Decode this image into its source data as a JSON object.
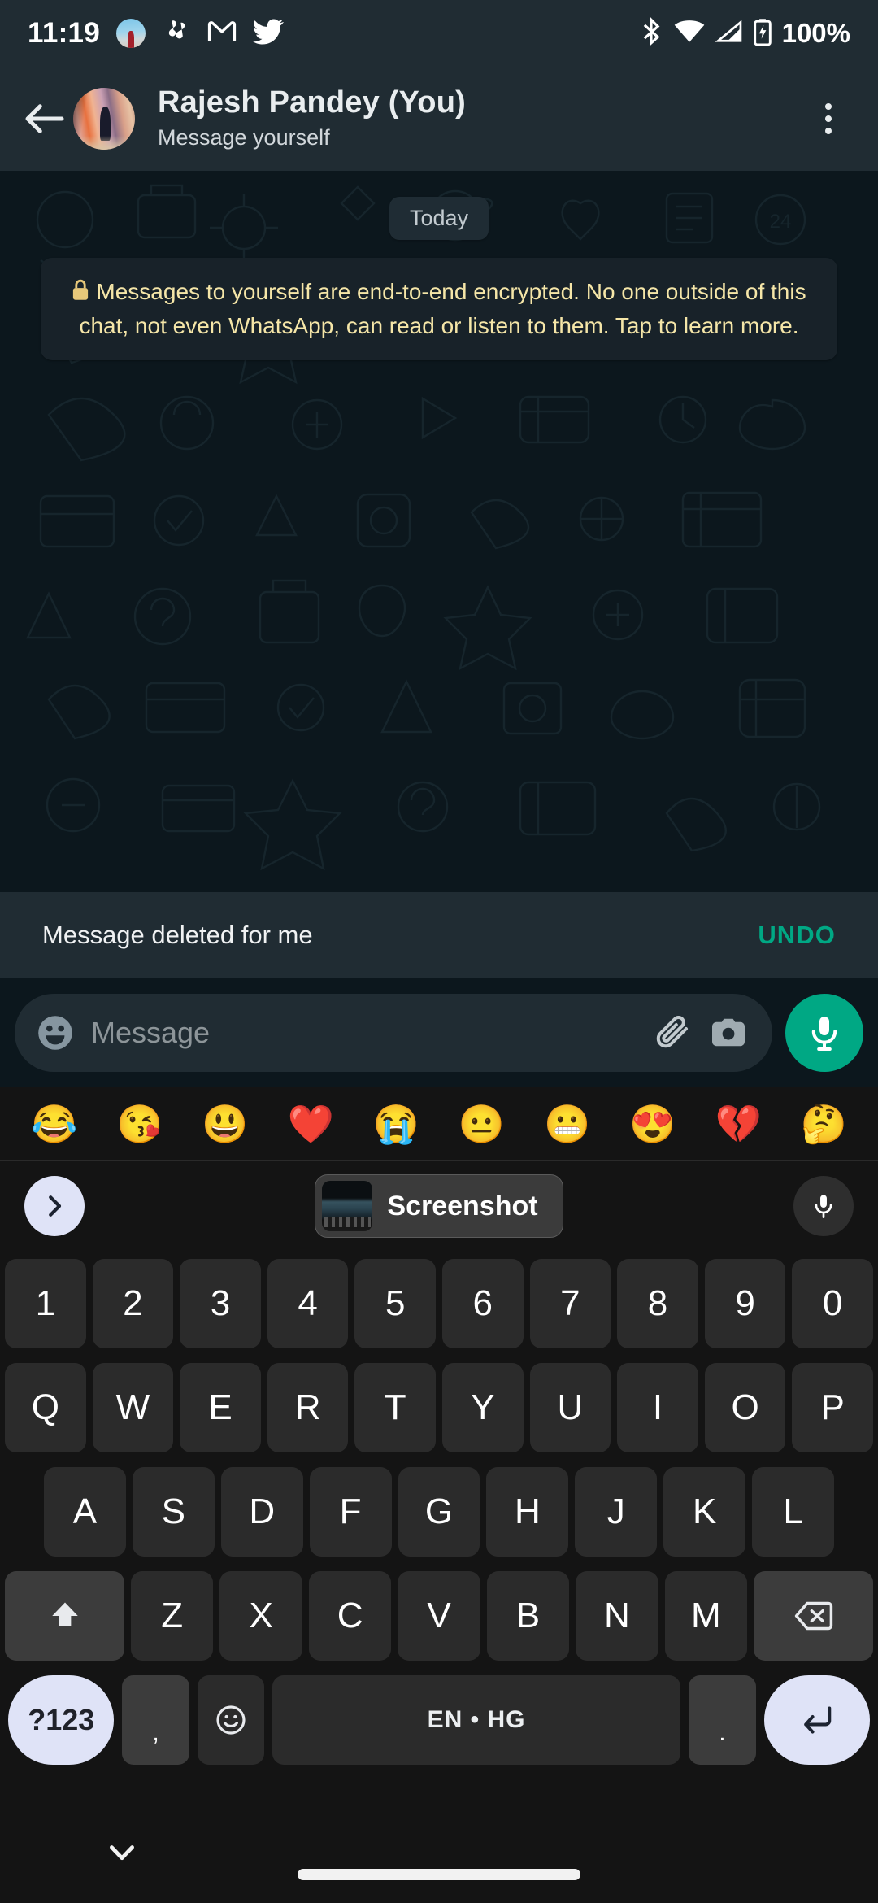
{
  "status_bar": {
    "time": "11:19",
    "battery_text": "100%",
    "left_icons": [
      "photo-notification-icon",
      "app-swirl-icon",
      "gmail-icon",
      "twitter-icon"
    ],
    "right_icons": [
      "bluetooth-icon",
      "wifi-icon",
      "cellular-signal-icon",
      "battery-charging-icon"
    ]
  },
  "header": {
    "back_label": "back-arrow",
    "title": "Rajesh Pandey (You)",
    "subtitle": "Message yourself",
    "menu_label": "more-options"
  },
  "chat": {
    "day_divider": "Today",
    "encryption_notice": "Messages to yourself are end-to-end encrypted. No one outside of this chat, not even WhatsApp, can read or listen to them. Tap to learn more.",
    "lock_icon": "lock-icon"
  },
  "snackbar": {
    "message": "Message deleted for me",
    "action": "UNDO",
    "action_color": "#00a884"
  },
  "input_bar": {
    "placeholder": "Message",
    "emoji_icon": "emoji-smiley-icon",
    "attach_icon": "paperclip-icon",
    "camera_icon": "camera-icon",
    "mic_icon": "microphone-icon",
    "mic_bg": "#00a884"
  },
  "emoji_suggestions": [
    "😂",
    "😘",
    "😃",
    "❤️",
    "😭",
    "😐",
    "😬",
    "😍",
    "💔",
    "🤔"
  ],
  "keyboard": {
    "toolbar": {
      "expand_icon": "chevron-right-icon",
      "suggestion_label": "Screenshot",
      "suggestion_thumb": "screenshot-thumbnail",
      "voice_icon": "microphone-icon"
    },
    "row_numbers": [
      "1",
      "2",
      "3",
      "4",
      "5",
      "6",
      "7",
      "8",
      "9",
      "0"
    ],
    "row_top": [
      "Q",
      "W",
      "E",
      "R",
      "T",
      "Y",
      "U",
      "I",
      "O",
      "P"
    ],
    "row_home": [
      "A",
      "S",
      "D",
      "F",
      "G",
      "H",
      "J",
      "K",
      "L"
    ],
    "row_bottom": [
      "Z",
      "X",
      "C",
      "V",
      "B",
      "N",
      "M"
    ],
    "shift_key": "shift-icon",
    "backspace_key": "backspace-icon",
    "symbols_key": "?123",
    "comma_key": ",",
    "emoji_key": "emoji-icon",
    "space_key": "EN • HG",
    "period_key": ".",
    "enter_key": "enter-icon"
  },
  "nav_bar": {
    "hide_keyboard_icon": "chevron-down-icon",
    "home_indicator": "home-gesture-bar"
  },
  "colors": {
    "header_bg": "#202c33",
    "chat_bg": "#0c171d",
    "accent_green": "#00a884",
    "encryption_text": "#f5e6a8",
    "keyboard_bg": "#141414",
    "key_bg": "#2b2b2b",
    "key_accent_bg": "#dfe3f7"
  }
}
